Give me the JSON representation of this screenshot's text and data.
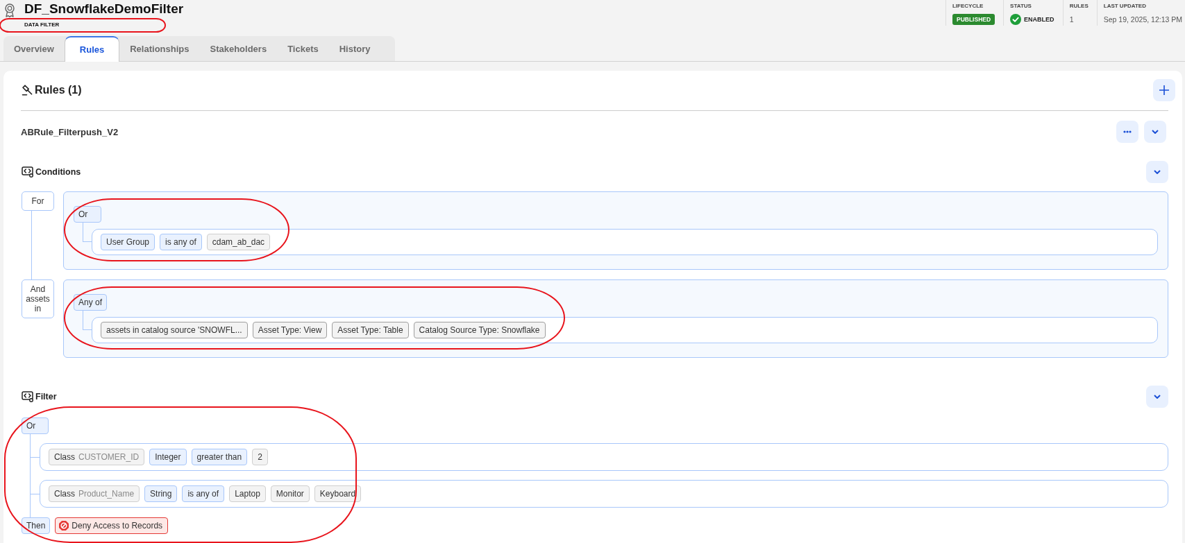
{
  "header": {
    "title": "DF_SnowflakeDemoFilter",
    "subtitle": "DATA FILTER",
    "subtitle_highlighted": true,
    "meta": [
      {
        "kind": "badge",
        "label": "LIFECYCLE",
        "value": "PUBLISHED"
      },
      {
        "kind": "status",
        "label": "STATUS",
        "value": "ENABLED"
      },
      {
        "kind": "text",
        "label": "RULES",
        "value": "1"
      },
      {
        "kind": "text",
        "label": "LAST UPDATED",
        "value": "Sep 19, 2025, 12:13 PM"
      }
    ]
  },
  "tabs": [
    {
      "label": "Overview",
      "selected": false
    },
    {
      "label": "Rules",
      "selected": true
    },
    {
      "label": "Relationships",
      "selected": false
    },
    {
      "label": "Stakeholders",
      "selected": false
    },
    {
      "label": "Tickets",
      "selected": false
    },
    {
      "label": "History",
      "selected": false
    }
  ],
  "rules_panel": {
    "title": "Rules (1)",
    "rules": [
      {
        "name": "ABRule_Filterpush_V2",
        "conditions": {
          "title": "Conditions",
          "clauses": [
            {
              "label": "For",
              "operator": "Or",
              "highlighted": true,
              "rows": [
                {
                  "tags": [
                    {
                      "kind": "attribute",
                      "text": "User Group"
                    },
                    {
                      "kind": "operator",
                      "text": "is any of"
                    },
                    {
                      "kind": "value",
                      "text": "cdam_ab_dac"
                    }
                  ]
                }
              ]
            },
            {
              "label": "And assets in",
              "operator": "Any of",
              "highlighted": true,
              "rows": [
                {
                  "tags": [
                    {
                      "kind": "asset",
                      "text": "assets in catalog source 'SNOWFL..."
                    },
                    {
                      "kind": "asset",
                      "text": "Asset Type: View"
                    },
                    {
                      "kind": "asset",
                      "text": "Asset Type: Table"
                    },
                    {
                      "kind": "asset",
                      "text": "Catalog Source Type: Snowflake"
                    }
                  ]
                }
              ]
            }
          ]
        },
        "filter": {
          "title": "Filter",
          "operator": "Or",
          "highlighted": true,
          "rows": [
            {
              "tags": [
                {
                  "kind": "class",
                  "label": "Class",
                  "text": "CUSTOMER_ID"
                },
                {
                  "kind": "type",
                  "text": "Integer"
                },
                {
                  "kind": "operator",
                  "text": "greater than"
                },
                {
                  "kind": "value",
                  "text": "2"
                }
              ]
            },
            {
              "tags": [
                {
                  "kind": "class",
                  "label": "Class",
                  "text": "Product_Name"
                },
                {
                  "kind": "type",
                  "text": "String"
                },
                {
                  "kind": "operator",
                  "text": "is any of"
                },
                {
                  "kind": "value",
                  "text": "Laptop"
                },
                {
                  "kind": "value",
                  "text": "Monitor"
                },
                {
                  "kind": "value",
                  "text": "Keyboard"
                }
              ]
            }
          ],
          "then_label": "Then",
          "action": {
            "kind": "deny",
            "text": "Deny Access to Records"
          }
        }
      }
    ]
  }
}
